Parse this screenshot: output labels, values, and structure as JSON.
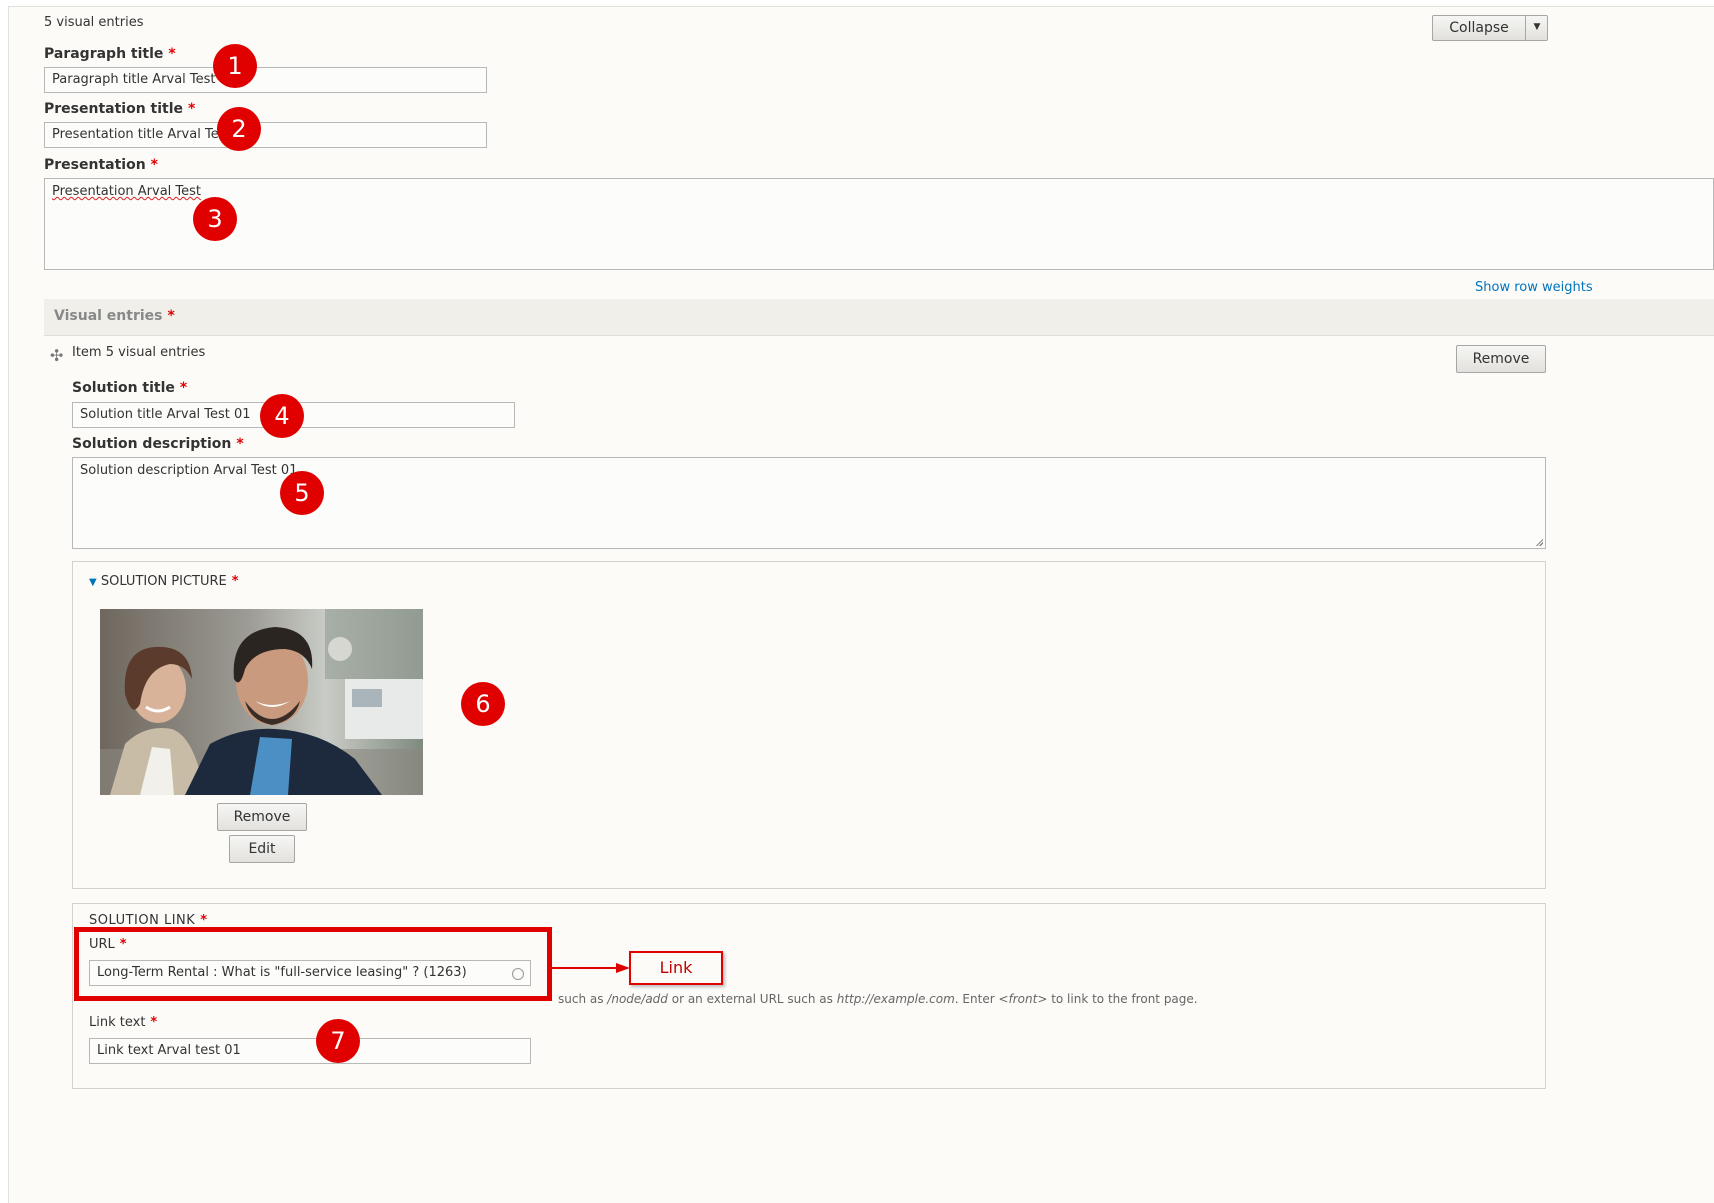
{
  "header": {
    "count_label": "5 visual entries",
    "collapse_label": "Collapse",
    "collapse_caret": "▼"
  },
  "fields": {
    "paragraph_title": {
      "label": "Paragraph title",
      "required": "*",
      "value": "Paragraph title Arval Test"
    },
    "presentation_title": {
      "label": "Presentation title",
      "required": "*",
      "value": "Presentation title Arval Test"
    },
    "presentation": {
      "label": "Presentation",
      "required": "*",
      "value": "Presentation Arval Test"
    }
  },
  "show_row_weights": "Show row weights",
  "visual_entries": {
    "label": "Visual entries",
    "required": "*",
    "item": {
      "drag_icon": "✣",
      "label": "Item 5 visual entries",
      "remove_label": "Remove",
      "solution_title": {
        "label": "Solution title",
        "required": "*",
        "value": "Solution title Arval Test 01"
      },
      "solution_description": {
        "label": "Solution description",
        "required": "*",
        "value": "Solution description Arval Test 01"
      },
      "solution_picture": {
        "toggle": "▼",
        "legend": "SOLUTION PICTURE",
        "required": "*",
        "remove_label": "Remove",
        "edit_label": "Edit"
      },
      "solution_link": {
        "legend": "SOLUTION LINK",
        "required": "*",
        "url": {
          "label": "URL",
          "required": "*",
          "value": "Long-Term Rental : What is \"full-service leasing\" ? (1263)"
        },
        "help_pre": "such as ",
        "help_node": "/node/add",
        "help_mid": " or an external URL such as ",
        "help_example": "http://example.com",
        "help_end": ". Enter ",
        "help_front": "<front>",
        "help_tail": " to link to the front page.",
        "link_callout": "Link",
        "link_text": {
          "label": "Link text",
          "required": "*",
          "value": "Link text Arval test 01"
        }
      }
    }
  },
  "markers": [
    "1",
    "2",
    "3",
    "4",
    "5",
    "6",
    "7"
  ],
  "colors": {
    "accent": "#e00000",
    "link": "#0074bd",
    "page_bg": "#fcfbf8"
  }
}
